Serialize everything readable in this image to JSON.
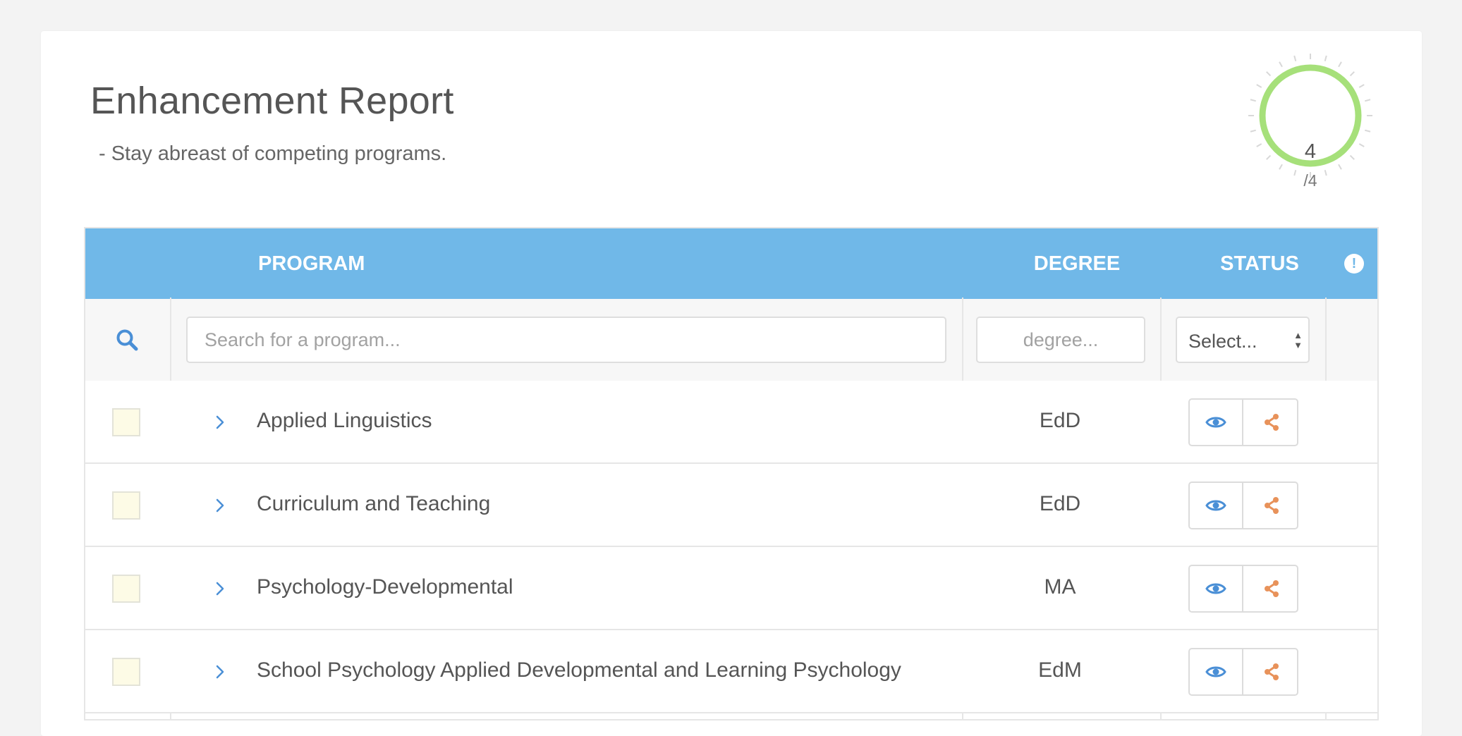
{
  "header": {
    "title": "Enhancement Report",
    "subtitle": "- Stay abreast of competing programs."
  },
  "gauge": {
    "value": "4",
    "total": "/4",
    "fraction": 1.0,
    "color": "#a6e07a"
  },
  "table": {
    "header_color": "#70b8e8",
    "columns": {
      "program": "PROGRAM",
      "degree": "DEGREE",
      "status": "STATUS",
      "info_icon": "exclamation-circle-icon"
    },
    "filters": {
      "search_icon": "search-icon",
      "program_placeholder": "Search for a program...",
      "degree_placeholder": "degree...",
      "status_select": "Select..."
    },
    "rows": [
      {
        "program": "Applied Linguistics",
        "degree": "EdD"
      },
      {
        "program": "Curriculum and Teaching",
        "degree": "EdD"
      },
      {
        "program": "Psychology-Developmental",
        "degree": "MA"
      },
      {
        "program": "School Psychology Applied Developmental and Learning Psychology",
        "degree": "EdM"
      }
    ],
    "action_icons": [
      "eye-icon",
      "share-icon"
    ],
    "action_colors": {
      "view": "#4a8fd6",
      "share": "#e8925a"
    }
  }
}
